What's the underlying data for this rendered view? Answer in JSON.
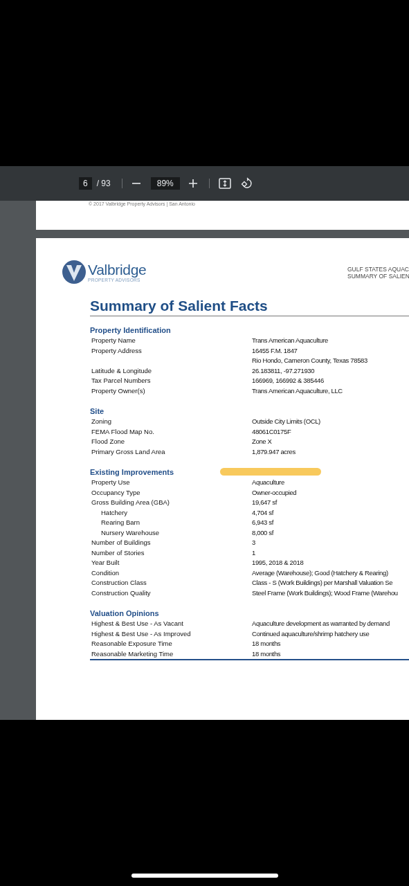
{
  "toolbar": {
    "page_current": "6",
    "page_total": "/ 93",
    "zoom": "89%"
  },
  "previous_page": {
    "footer": "© 2017 Valbridge Property Advisors | San Antonio"
  },
  "page": {
    "logo": {
      "name": "Valbridge",
      "tagline": "PROPERTY ADVISORS"
    },
    "header_lines": [
      "GULF STATES AQUAC",
      "SUMMARY OF SALIEN"
    ],
    "title": "Summary of Salient Facts",
    "sections": [
      {
        "heading": "Property Identification",
        "rows": [
          {
            "label": "Property Name",
            "value": "Trans American Aquaculture"
          },
          {
            "label": "Property Address",
            "value": "16455 F.M. 1847"
          },
          {
            "value": "Rio Hondo, Cameron County, Texas 78583"
          },
          {
            "label": "Latitude & Longitude",
            "value": "26.183811, -97.271930"
          },
          {
            "label": "Tax Parcel Numbers",
            "value": "166969, 166992 & 385446"
          },
          {
            "label": "Property Owner(s)",
            "value": "Trans American Aquaculture, LLC"
          }
        ]
      },
      {
        "heading": "Site",
        "rows": [
          {
            "label": "Zoning",
            "value": "Outside City Limits (OCL)"
          },
          {
            "label": "FEMA Flood Map No.",
            "value": "48061C0175F"
          },
          {
            "label": "Flood Zone",
            "value": "Zone X"
          },
          {
            "label": "Primary Gross Land Area",
            "value": "1,879.947 acres"
          }
        ]
      },
      {
        "heading": "Existing Improvements",
        "rows": [
          {
            "label": "Property Use",
            "value": "Aquaculture"
          },
          {
            "label": "Occupancy Type",
            "value": "Owner-occupied"
          },
          {
            "label": "Gross Building Area (GBA)",
            "value": "19,647 sf",
            "children": [
              {
                "label": "Hatchery",
                "value": "4,704 sf"
              },
              {
                "label": "Rearing Barn",
                "value": "6,943 sf"
              },
              {
                "label": "Nursery Warehouse",
                "value": "8,000 sf"
              }
            ]
          },
          {
            "label": "Number of Buildings",
            "value": "3"
          },
          {
            "label": "Number of Stories",
            "value": "1"
          },
          {
            "label": "Year Built",
            "value": "1995, 2018 & 2018"
          },
          {
            "label": "Condition",
            "value": "Average (Warehouse); Good (Hatchery & Rearing)"
          },
          {
            "label": "Construction Class",
            "value": "Class - S (Work Buildings) per Marshall Valuation Se"
          },
          {
            "label": "Construction Quality",
            "value": "Steel Frame (Work Buildings); Wood Frame (Warehou"
          }
        ]
      },
      {
        "heading": "Valuation Opinions",
        "rows": [
          {
            "label": "Highest & Best Use - As Vacant",
            "value": "Aquaculture development as warranted by demand"
          },
          {
            "label": "Highest & Best Use - As Improved",
            "value": "Continued aquaculture/shrimp hatchery use"
          },
          {
            "label": "Reasonable Exposure Time",
            "value": "18 months"
          },
          {
            "label": "Reasonable Marketing Time",
            "value": "18 months"
          }
        ]
      }
    ]
  }
}
